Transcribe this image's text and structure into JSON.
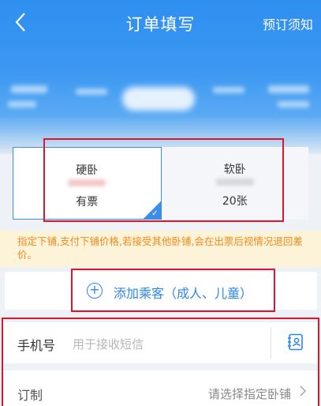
{
  "nav": {
    "title": "订单填写",
    "notice": "预订须知",
    "back_icon": "chevron-left-icon"
  },
  "seats": [
    {
      "name": "硬卧",
      "count": "有票",
      "selected": true
    },
    {
      "name": "软卧",
      "count": "20张",
      "selected": false
    }
  ],
  "warning": "指定下铺,支付下铺价格,若接受其他卧铺,会在出票后视情况退回差价。",
  "add_passenger": {
    "label": "添加乘客（成人、儿童）",
    "icon": "plus-circle-icon"
  },
  "form": {
    "phone_label": "手机号",
    "phone_placeholder": "用于接收短信",
    "contact_icon": "contact-book-icon",
    "custom_label": "订制",
    "custom_value": "请选择指定卧铺"
  },
  "colors": {
    "primary": "#2f86e6",
    "highlight": "#e0152b",
    "warning_text": "#f18a1c",
    "warning_bg": "#fdf3d8"
  }
}
